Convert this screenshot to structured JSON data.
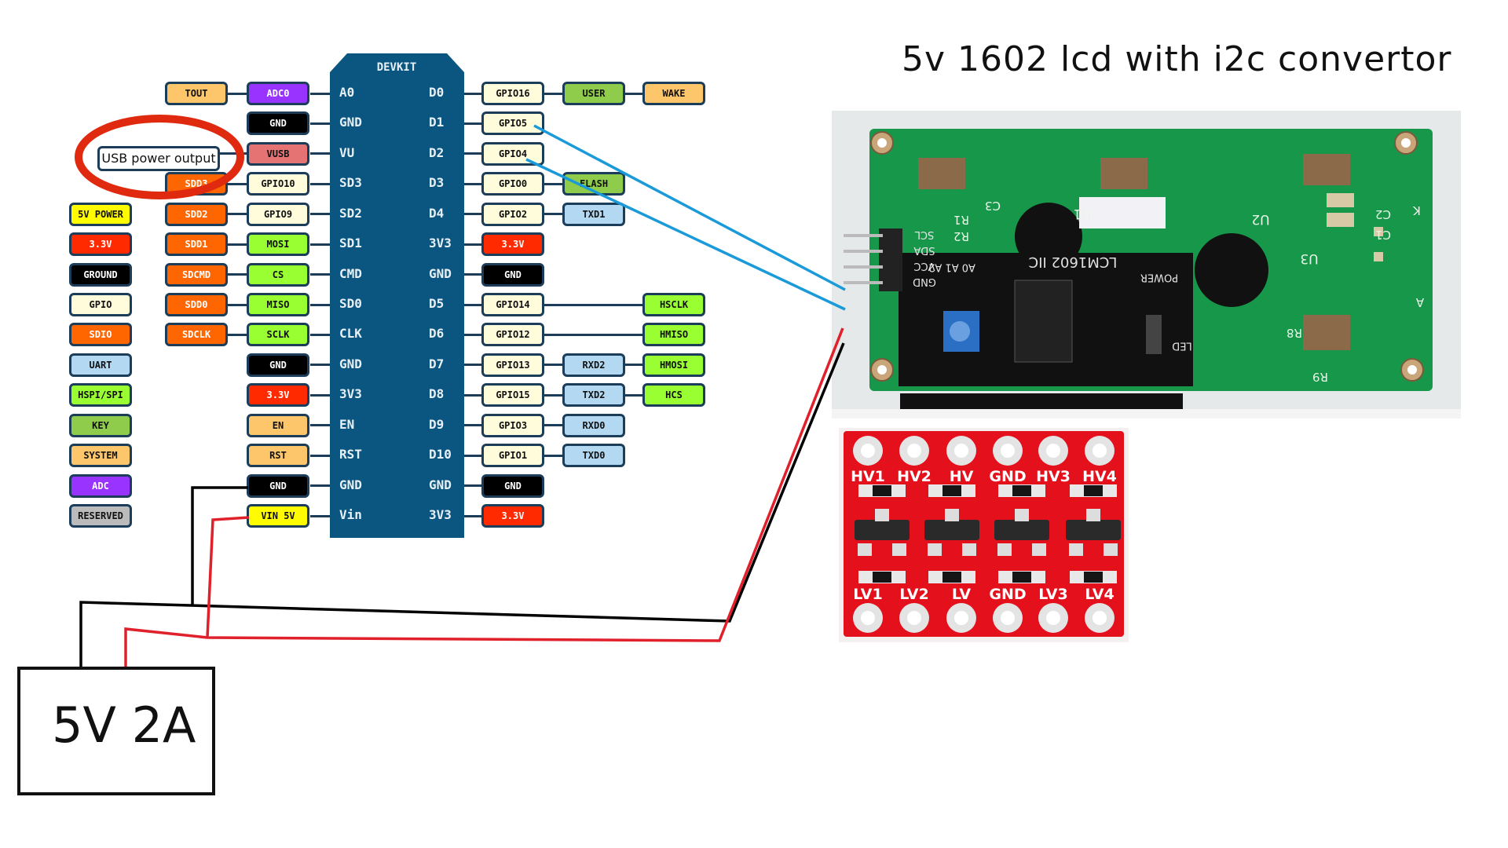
{
  "title": "5v 1602 lcd with i2c convertor",
  "board": {
    "name": "DEVKIT",
    "color": "#0b5680"
  },
  "annotation": {
    "usb_note": "USB power output",
    "circle_color": "#e02a10"
  },
  "power_supply": {
    "label": "5V 2A"
  },
  "colors": {
    "system": {
      "bg": "#fdc66a",
      "fg": "#111111"
    },
    "adc": {
      "bg": "#9933ff",
      "fg": "#ffffff"
    },
    "ground": {
      "bg": "#000000",
      "fg": "#ffffff"
    },
    "vusb": {
      "bg": "#e57373",
      "fg": "#111111"
    },
    "power5": {
      "bg": "#fffc00",
      "fg": "#111111"
    },
    "power33": {
      "bg": "#ff2a00",
      "fg": "#ffffff"
    },
    "gpio": {
      "bg": "#fffcdc",
      "fg": "#111111"
    },
    "sdio": {
      "bg": "#ff6600",
      "fg": "#ffffff"
    },
    "spi": {
      "bg": "#99ff33",
      "fg": "#111111"
    },
    "uart": {
      "bg": "#b3d9f2",
      "fg": "#111111"
    },
    "key": {
      "bg": "#8fcc4c",
      "fg": "#111111"
    },
    "reserved": {
      "bg": "#bbbbbb",
      "fg": "#111111"
    }
  },
  "legend": [
    {
      "text": "5V POWER",
      "cat": "power5"
    },
    {
      "text": "3.3V",
      "cat": "power33"
    },
    {
      "text": "GROUND",
      "cat": "ground"
    },
    {
      "text": "GPIO",
      "cat": "gpio"
    },
    {
      "text": "SDIO",
      "cat": "sdio"
    },
    {
      "text": "UART",
      "cat": "uart"
    },
    {
      "text": "HSPI/SPI",
      "cat": "spi"
    },
    {
      "text": "KEY",
      "cat": "key"
    },
    {
      "text": "SYSTEM",
      "cat": "system"
    },
    {
      "text": "ADC",
      "cat": "adc"
    },
    {
      "text": "RESERVED",
      "cat": "reserved"
    }
  ],
  "pins": [
    {
      "left": "A0",
      "right": "D0",
      "l": [
        {
          "text": "TOUT",
          "cat": "system"
        },
        {
          "text": "ADC0",
          "cat": "adc"
        }
      ],
      "r": [
        {
          "text": "GPIO16",
          "cat": "gpio"
        },
        {
          "text": "USER",
          "cat": "key"
        },
        {
          "text": "WAKE",
          "cat": "system"
        }
      ]
    },
    {
      "left": "GND",
      "right": "D1",
      "l": [
        null,
        {
          "text": "GND",
          "cat": "ground"
        }
      ],
      "r": [
        {
          "text": "GPIO5",
          "cat": "gpio"
        }
      ]
    },
    {
      "left": "VU",
      "right": "D2",
      "l": [
        null,
        {
          "text": "VUSB",
          "cat": "vusb"
        }
      ],
      "r": [
        {
          "text": "GPIO4",
          "cat": "gpio"
        }
      ]
    },
    {
      "left": "SD3",
      "right": "D3",
      "l": [
        {
          "text": "SDD3",
          "cat": "sdio"
        },
        {
          "text": "GPIO10",
          "cat": "gpio"
        }
      ],
      "r": [
        {
          "text": "GPIO0",
          "cat": "gpio"
        },
        {
          "text": "FLASH",
          "cat": "key"
        }
      ]
    },
    {
      "left": "SD2",
      "right": "D4",
      "l": [
        {
          "text": "SDD2",
          "cat": "sdio"
        },
        {
          "text": "GPIO9",
          "cat": "gpio"
        }
      ],
      "r": [
        {
          "text": "GPIO2",
          "cat": "gpio"
        },
        {
          "text": "TXD1",
          "cat": "uart"
        }
      ]
    },
    {
      "left": "SD1",
      "right": "3V3",
      "l": [
        {
          "text": "SDD1",
          "cat": "sdio"
        },
        {
          "text": "MOSI",
          "cat": "spi"
        }
      ],
      "r": [
        {
          "text": "3.3V",
          "cat": "power33"
        }
      ]
    },
    {
      "left": "CMD",
      "right": "GND",
      "l": [
        {
          "text": "SDCMD",
          "cat": "sdio"
        },
        {
          "text": "CS",
          "cat": "spi"
        }
      ],
      "r": [
        {
          "text": "GND",
          "cat": "ground"
        }
      ]
    },
    {
      "left": "SD0",
      "right": "D5",
      "l": [
        {
          "text": "SDD0",
          "cat": "sdio"
        },
        {
          "text": "MISO",
          "cat": "spi"
        }
      ],
      "r": [
        {
          "text": "GPIO14",
          "cat": "gpio"
        },
        null,
        {
          "text": "HSCLK",
          "cat": "spi"
        }
      ]
    },
    {
      "left": "CLK",
      "right": "D6",
      "l": [
        {
          "text": "SDCLK",
          "cat": "sdio"
        },
        {
          "text": "SCLK",
          "cat": "spi"
        }
      ],
      "r": [
        {
          "text": "GPIO12",
          "cat": "gpio"
        },
        null,
        {
          "text": "HMISO",
          "cat": "spi"
        }
      ]
    },
    {
      "left": "GND",
      "right": "D7",
      "l": [
        null,
        {
          "text": "GND",
          "cat": "ground"
        }
      ],
      "r": [
        {
          "text": "GPIO13",
          "cat": "gpio"
        },
        {
          "text": "RXD2",
          "cat": "uart"
        },
        {
          "text": "HMOSI",
          "cat": "spi"
        }
      ]
    },
    {
      "left": "3V3",
      "right": "D8",
      "l": [
        null,
        {
          "text": "3.3V",
          "cat": "power33"
        }
      ],
      "r": [
        {
          "text": "GPIO15",
          "cat": "gpio"
        },
        {
          "text": "TXD2",
          "cat": "uart"
        },
        {
          "text": "HCS",
          "cat": "spi"
        }
      ]
    },
    {
      "left": "EN",
      "right": "D9",
      "l": [
        null,
        {
          "text": "EN",
          "cat": "system"
        }
      ],
      "r": [
        {
          "text": "GPIO3",
          "cat": "gpio"
        },
        {
          "text": "RXD0",
          "cat": "uart"
        }
      ]
    },
    {
      "left": "RST",
      "right": "D10",
      "l": [
        null,
        {
          "text": "RST",
          "cat": "system"
        }
      ],
      "r": [
        {
          "text": "GPIO1",
          "cat": "gpio"
        },
        {
          "text": "TXD0",
          "cat": "uart"
        }
      ]
    },
    {
      "left": "GND",
      "right": "GND",
      "l": [
        null,
        {
          "text": "GND",
          "cat": "ground"
        }
      ],
      "r": [
        {
          "text": "GND",
          "cat": "ground"
        }
      ]
    },
    {
      "left": "Vin",
      "right": "3V3",
      "l": [
        null,
        {
          "text": "VIN 5V",
          "cat": "power5"
        }
      ],
      "r": [
        {
          "text": "3.3V",
          "cat": "power33"
        }
      ]
    }
  ],
  "wires": {
    "i2c_color": "#1a9ad8",
    "vcc_color": "#e0202a",
    "gnd_color": "#000000"
  },
  "lcd_photo": {
    "backpack_label": "LCM1602 IIC",
    "header_pins": [
      "SCL",
      "SDA",
      "VCC",
      "GND"
    ],
    "silkscreen": [
      "A0 A1 A2",
      "POWER",
      "LED",
      "U1",
      "U2",
      "U3",
      "C1",
      "C2",
      "C3",
      "R1",
      "R2",
      "R8",
      "R9",
      "K",
      "A"
    ]
  },
  "level_shifter": {
    "top_labels": [
      "HV1",
      "HV2",
      "HV",
      "GND",
      "HV3",
      "HV4"
    ],
    "bottom_labels": [
      "LV1",
      "LV2",
      "LV",
      "GND",
      "LV3",
      "LV4"
    ]
  }
}
